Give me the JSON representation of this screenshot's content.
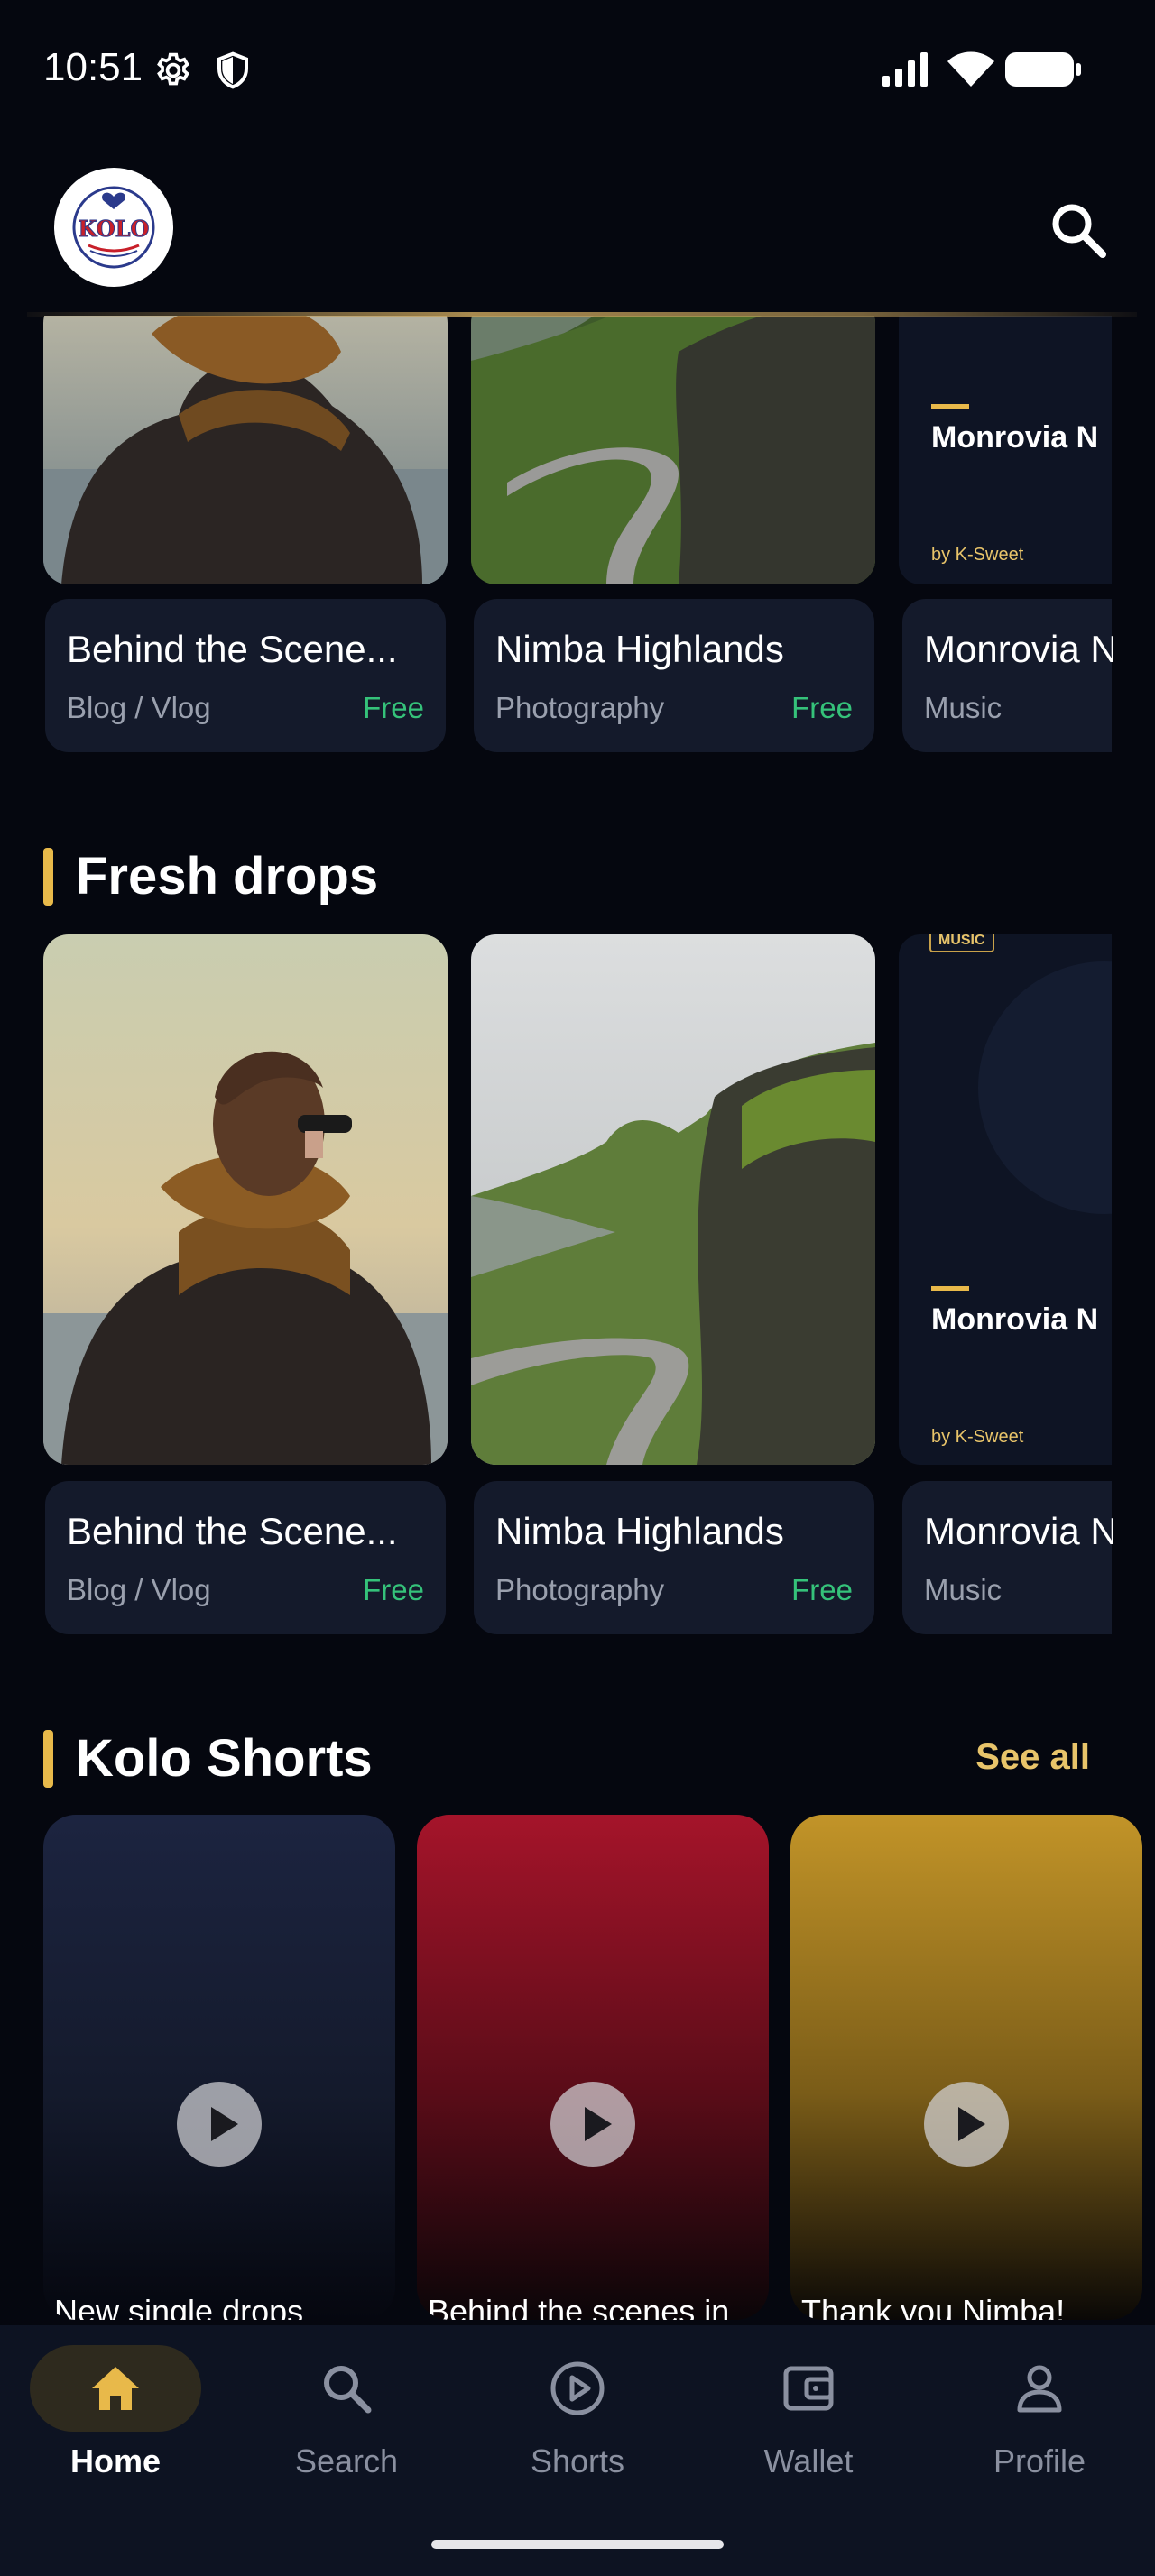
{
  "status_bar": {
    "time": "10:51"
  },
  "header": {
    "logo_text": "KOLO"
  },
  "top_row": [
    {
      "title": "Behind the Scene...",
      "category": "Blog / Vlog",
      "price": "Free"
    },
    {
      "title": "Nimba Highlands",
      "category": "Photography",
      "price": "Free"
    },
    {
      "title": "Monrovia N",
      "category": "Music",
      "poster_title": "Monrovia N",
      "poster_by": "by K-Sweet"
    }
  ],
  "fresh_drops": {
    "heading": "Fresh drops",
    "items": [
      {
        "title": "Behind the Scene...",
        "category": "Blog / Vlog",
        "price": "Free"
      },
      {
        "title": "Nimba Highlands",
        "category": "Photography",
        "price": "Free"
      },
      {
        "title": "Monrovia N",
        "category": "Music",
        "badge": "MUSIC",
        "poster_title": "Monrovia N",
        "poster_by": "by K-Sweet"
      }
    ]
  },
  "shorts": {
    "heading": "Kolo Shorts",
    "see_all": "See all",
    "items": [
      {
        "title": "New single drops"
      },
      {
        "title": "Behind the scenes in"
      },
      {
        "title": "Thank you Nimba!"
      }
    ]
  },
  "nav": [
    {
      "label": "Home",
      "icon": "home-icon",
      "active": true
    },
    {
      "label": "Search",
      "icon": "search-icon"
    },
    {
      "label": "Shorts",
      "icon": "play-circle-icon"
    },
    {
      "label": "Wallet",
      "icon": "wallet-icon"
    },
    {
      "label": "Profile",
      "icon": "profile-icon"
    }
  ],
  "colors": {
    "accent": "#e8b94a",
    "free": "#35c27a",
    "background": "#05070f",
    "card": "#141a2b"
  }
}
